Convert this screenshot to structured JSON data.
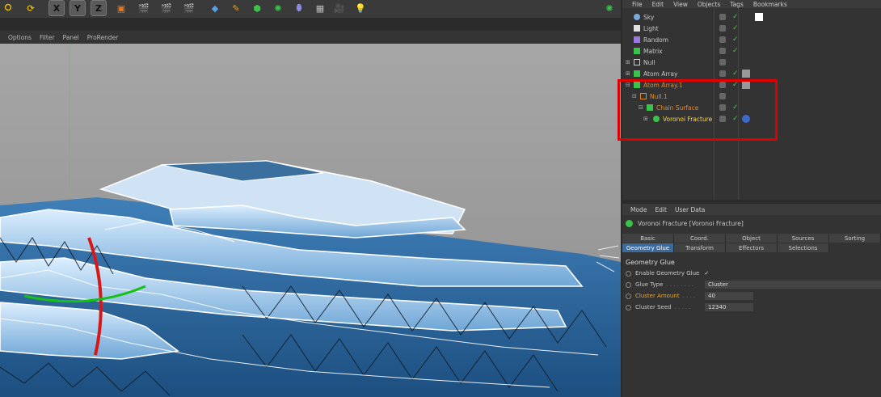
{
  "viewport_menu": [
    "Options",
    "Filter",
    "Panel",
    "ProRender"
  ],
  "toolbar": {
    "axes": [
      "X",
      "Y",
      "Z"
    ]
  },
  "object_manager": {
    "menu": [
      "File",
      "Edit",
      "View",
      "Objects",
      "Tags",
      "Bookmarks"
    ],
    "objects": [
      {
        "name": "Sky",
        "color": "#c8c8c8"
      },
      {
        "name": "Light",
        "color": "#c8c8c8"
      },
      {
        "name": "Random",
        "color": "#c8c8c8"
      },
      {
        "name": "Matrix",
        "color": "#c8c8c8"
      },
      {
        "name": "Null",
        "color": "#c8c8c8"
      },
      {
        "name": "Atom Array",
        "color": "#c8c8c8"
      },
      {
        "name": "Atom Array.1",
        "color": "#e08a2a"
      },
      {
        "name": "Null.1",
        "color": "#e08a2a"
      },
      {
        "name": "Chain Surface",
        "color": "#e08a2a"
      },
      {
        "name": "Voronoi Fracture",
        "color": "#ffd84a"
      }
    ]
  },
  "attribute_manager": {
    "menu": [
      "Mode",
      "Edit",
      "User Data"
    ],
    "title": "Voronoi Fracture [Voronoi Fracture]",
    "tabs_row1": [
      "Basic",
      "Coord.",
      "Object",
      "Sources",
      "Sorting"
    ],
    "tabs_row2": [
      "Geometry Glue",
      "Transform",
      "Effectors",
      "Selections"
    ],
    "active_tab": "Geometry Glue",
    "section_title": "Geometry Glue",
    "properties": {
      "enable_label": "Enable Geometry Glue",
      "enable_value": "✓",
      "glue_type_label": "Glue Type",
      "glue_type_value": "Cluster",
      "cluster_amount_label": "Cluster Amount",
      "cluster_amount_value": "40",
      "cluster_seed_label": "Cluster Seed",
      "cluster_seed_value": "12340"
    }
  },
  "colors": {
    "highlight_box": "#e10000",
    "active_tab": "#3b6a9c",
    "selected_object": "#ffd84a",
    "child_object": "#e08a2a"
  }
}
